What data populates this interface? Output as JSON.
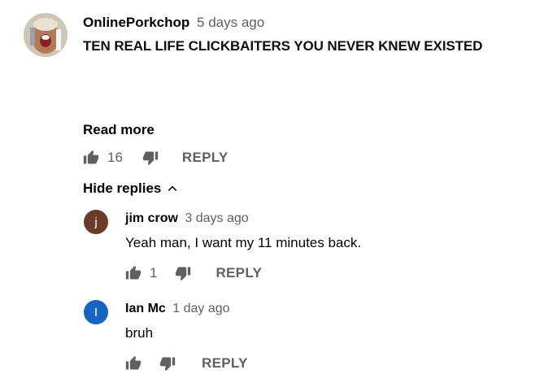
{
  "main_comment": {
    "author": "OnlinePorkchop",
    "time": "5 days ago",
    "text": "TEN REAL LIFE CLICKBAITERS YOU NEVER KNEW EXISTED",
    "read_more": "Read more",
    "like_count": "16",
    "reply_label": "REPLY",
    "hide_replies": "Hide replies"
  },
  "replies": [
    {
      "avatar_letter": "j",
      "avatar_color": "#6b3b2a",
      "author": "jim crow",
      "time": "3 days ago",
      "text": "Yeah man, I want my 11 minutes back.",
      "like_count": "1",
      "reply_label": "REPLY"
    },
    {
      "avatar_letter": "I",
      "avatar_color": "#1565c0",
      "author": "Ian Mc",
      "time": "1 day ago",
      "text": "bruh",
      "like_count": "",
      "reply_label": "REPLY"
    }
  ],
  "icons": {
    "like": "thumb-up-icon",
    "dislike": "thumb-down-icon",
    "collapse": "chevron-up-icon"
  }
}
